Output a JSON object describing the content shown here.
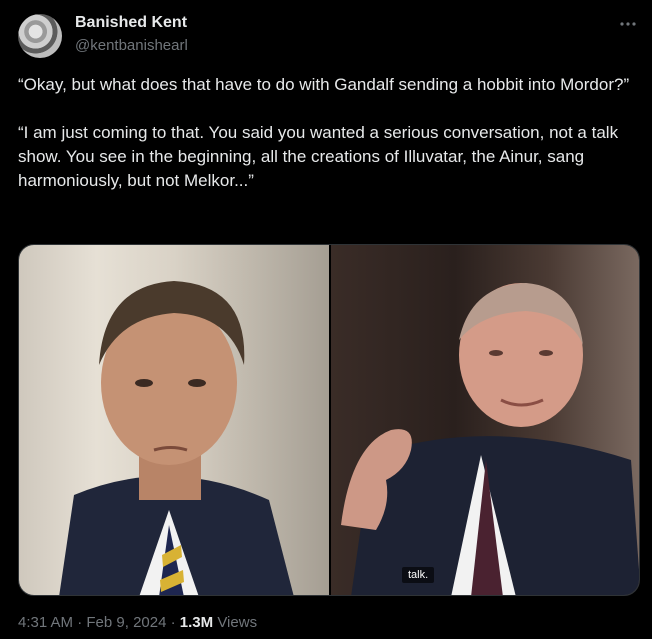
{
  "author": {
    "name": "Banished Kent",
    "handle": "@kentbanishearl"
  },
  "post": {
    "paragraphs": [
      "“Okay, but what does that have to do with Gandalf sending a hobbit into Mordor?”",
      "“I am just coming to that. You said you wanted a serious conversation, not a talk show. You see in the beginning, all the creations of Illuvatar, the Ainur, sang harmoniously, but not Melkor...”"
    ],
    "media_caption": "talk."
  },
  "meta": {
    "time": "4:31 AM",
    "separator": "·",
    "date": "Feb 9, 2024",
    "views_count": "1.3M",
    "views_label": "Views"
  },
  "icons": {
    "more": "more-horizontal-icon"
  },
  "colors": {
    "background": "#000000",
    "text_primary": "#e7e9ea",
    "text_secondary": "#71767b",
    "border": "#2f3336"
  }
}
